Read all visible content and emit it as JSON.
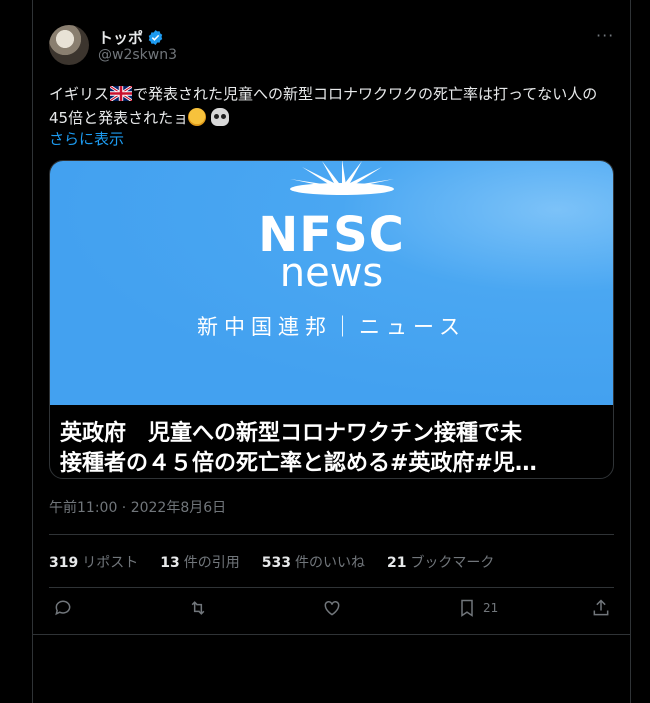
{
  "author": {
    "display_name": "トッポ",
    "handle": "@w2skwn3",
    "verified": true
  },
  "post": {
    "text_part1": "イギリス",
    "text_part2": "で発表された児童への新型コロナワクワクの死亡率は打ってない人の45倍と発表された",
    "text_part3": "ョ",
    "show_more": "さらに表示"
  },
  "card": {
    "logo_line1": "NFSC",
    "logo_line2": "news",
    "logo_line3": "新中国連邦｜ニュース",
    "title_line1": "英政府　児童への新型コロナワクチン接種で未",
    "title_line2": "接種者の４５倍の死亡率と認める#英政府#児…"
  },
  "timestamp": "午前11:00 · 2022年8月6日",
  "stats": [
    {
      "count": "319",
      "label": "リポスト"
    },
    {
      "count": "13",
      "label": "件の引用"
    },
    {
      "count": "533",
      "label": "件のいいね"
    },
    {
      "count": "21",
      "label": "ブックマーク"
    }
  ],
  "actions": {
    "bookmark_count": "21"
  },
  "colors": {
    "accent": "#1d9bf0",
    "card_bg": "#43a1f0",
    "muted": "#71767b"
  },
  "icons": [
    "more-icon",
    "verified-badge-icon",
    "uk-flag-icon",
    "face-emoji-icon",
    "skull-emoji-icon",
    "reply-icon",
    "repost-icon",
    "like-icon",
    "bookmark-icon",
    "share-icon"
  ]
}
